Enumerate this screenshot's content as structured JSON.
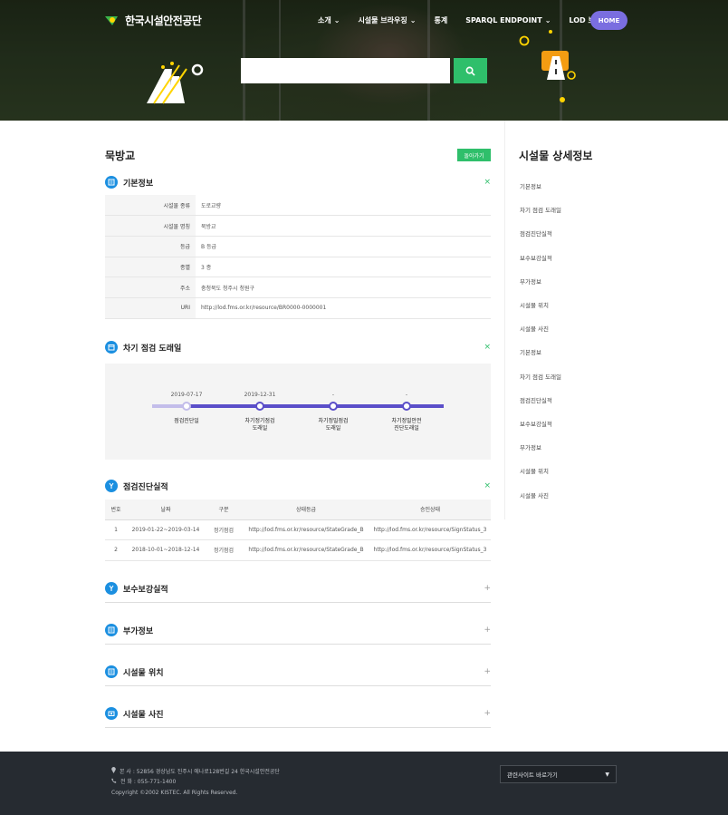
{
  "header": {
    "logo_text": "한국시설안전공단",
    "nav": [
      {
        "label": "소개",
        "has_dropdown": true
      },
      {
        "label": "시설물 브라우징",
        "has_dropdown": true
      },
      {
        "label": "통계",
        "has_dropdown": false
      },
      {
        "label": "SPARQL ENDPOINT",
        "has_dropdown": true
      },
      {
        "label": "LOD 브라우징",
        "has_dropdown": false
      }
    ],
    "home_label": "HOME",
    "search_value": "",
    "search_icon": "search-icon"
  },
  "main": {
    "title": "묵방교",
    "back_label": "돌아가기",
    "basic": {
      "title": "기본정보",
      "toggle": "×",
      "rows": [
        {
          "key": "시설물 종류",
          "value": "도로교량"
        },
        {
          "key": "시설물 명칭",
          "value": "묵방교"
        },
        {
          "key": "등급",
          "value": "B 등급"
        },
        {
          "key": "종별",
          "value": "3 종"
        },
        {
          "key": "주소",
          "value": "충청북도 청주시 청원구"
        },
        {
          "key": "URI",
          "value": "http://lod.fms.or.kr/resource/BR0000-0000001"
        }
      ]
    },
    "timeline": {
      "title": "차기 점검 도래일",
      "toggle": "×",
      "steps": [
        {
          "date": "2019-07-17",
          "label": "점검진단일"
        },
        {
          "date": "2019-12-31",
          "label": "차기정기점검\n도래일"
        },
        {
          "date": "-",
          "label": "차기정밀점검\n도래일"
        },
        {
          "date": "-",
          "label": "차기정밀안전\n진단도래일"
        }
      ],
      "progress_fraction": 0.12
    },
    "results": {
      "title": "점검진단실적",
      "toggle": "×",
      "headers": [
        "번호",
        "날짜",
        "구분",
        "상태등급",
        "승인상태"
      ],
      "rows": [
        [
          "1",
          "2019-01-22~2019-03-14",
          "정기점검",
          "http://lod.fms.or.kr/resource/StateGrade_B",
          "http://lod.fms.or.kr/resource/SignStatus_3"
        ],
        [
          "2",
          "2018-10-01~2018-12-14",
          "정기점검",
          "http://lod.fms.or.kr/resource/StateGrade_B",
          "http://lod.fms.or.kr/resource/SignStatus_3"
        ]
      ]
    },
    "collapsed": [
      {
        "title": "보수보강실적",
        "toggle": "+"
      },
      {
        "title": "부가정보",
        "toggle": "+"
      },
      {
        "title": "시설물 위치",
        "toggle": "+"
      },
      {
        "title": "시설물 사진",
        "toggle": "+"
      }
    ]
  },
  "sidebar": {
    "title": "시설물 상세정보",
    "items": [
      "기본정보",
      "차기 점검 도래일",
      "점검진단실적",
      "보수보강실적",
      "부가정보",
      "시설물 위치",
      "시설물 사진",
      "기본정보",
      "차기 점검 도래일",
      "점검진단실적",
      "보수보강실적",
      "부가정보",
      "시설물 위치",
      "시설물 사진"
    ]
  },
  "footer": {
    "address": "본 사 : 52856 경상남도 진주시 에나로128번길 24 한국시설안전공단",
    "phone": "전 화 : 055-771-1400",
    "copyright": "Copyright ©2002 KISTEC. All Rights Reserved.",
    "related_select": "관련사이트 바로가기"
  },
  "colors": {
    "accent_green": "#2fbf6b",
    "home_purple": "#7a6ee0",
    "section_icon_blue": "#1b8fe0",
    "timeline_purple": "#5b4fc9",
    "footer_bg": "#262b31"
  }
}
